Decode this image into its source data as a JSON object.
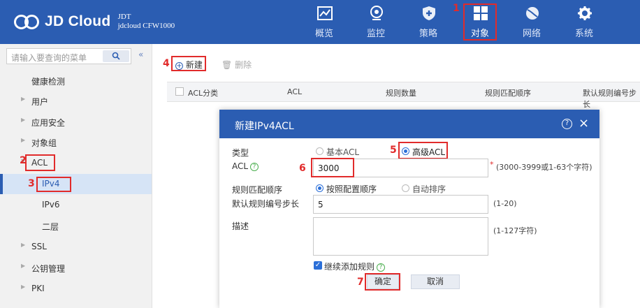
{
  "app": {
    "brand": "JD Cloud",
    "model_line1": "JDT",
    "model_line2": "jdcloud CFW1000"
  },
  "topnav": [
    {
      "label": "概览",
      "icon": "chart-icon"
    },
    {
      "label": "监控",
      "icon": "monitor-icon"
    },
    {
      "label": "策略",
      "icon": "shield-icon"
    },
    {
      "label": "对象",
      "icon": "grid-icon",
      "active": true
    },
    {
      "label": "网络",
      "icon": "globe-icon"
    },
    {
      "label": "系统",
      "icon": "gear-icon"
    }
  ],
  "sidebar": {
    "search_placeholder": "请输入要查询的菜单",
    "collapse_icon": "double-chevron-left-icon",
    "items": [
      {
        "label": "健康检测"
      },
      {
        "label": "用户"
      },
      {
        "label": "应用安全"
      },
      {
        "label": "对象组"
      },
      {
        "label": "ACL"
      },
      {
        "label": "IPv4"
      },
      {
        "label": "IPv6"
      },
      {
        "label": "二层"
      },
      {
        "label": "SSL"
      },
      {
        "label": "公钥管理"
      },
      {
        "label": "PKI"
      }
    ]
  },
  "toolbar": {
    "new_label": "新建",
    "delete_label": "删除"
  },
  "table": {
    "columns": [
      "ACL分类",
      "ACL",
      "规则数量",
      "规则匹配顺序",
      "默认规则编号步长"
    ]
  },
  "dialog": {
    "title": "新建IPv4ACL",
    "type_label": "类型",
    "type_options": [
      "基本ACL",
      "高级ACL"
    ],
    "type_selected": "高级ACL",
    "acl_label": "ACL",
    "acl_value": "3000",
    "acl_hint": "(3000-3999或1-63个字符)",
    "required_mark": "*",
    "order_label": "规则匹配顺序",
    "order_options": [
      "按照配置顺序",
      "自动排序"
    ],
    "order_selected": "按照配置顺序",
    "step_label": "默认规则编号步长",
    "step_value": "5",
    "step_hint": "(1-20)",
    "desc_label": "描述",
    "desc_value": "",
    "desc_hint": "(1-127字符)",
    "continue_label": "继续添加规则",
    "continue_checked": true,
    "ok_label": "确定",
    "cancel_label": "取消"
  },
  "annotations": [
    "1",
    "2",
    "3",
    "4",
    "5",
    "6",
    "7"
  ],
  "colors": {
    "header_blue": "#2b5db2",
    "annotation_red": "#e12b2b",
    "radio_blue": "#2b6fd8"
  }
}
